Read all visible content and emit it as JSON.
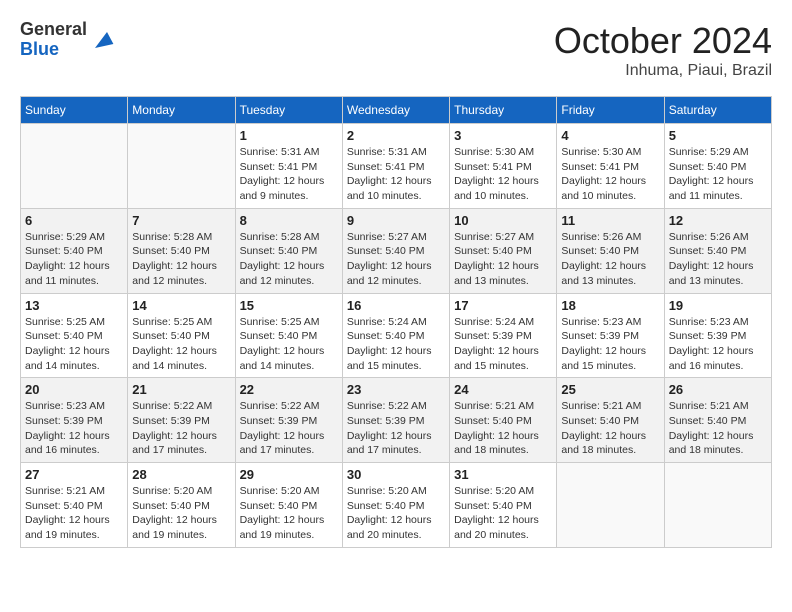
{
  "header": {
    "logo_general": "General",
    "logo_blue": "Blue",
    "month": "October 2024",
    "location": "Inhuma, Piaui, Brazil"
  },
  "weekdays": [
    "Sunday",
    "Monday",
    "Tuesday",
    "Wednesday",
    "Thursday",
    "Friday",
    "Saturday"
  ],
  "weeks": [
    [
      {
        "day": "",
        "sunrise": "",
        "sunset": "",
        "daylight": ""
      },
      {
        "day": "",
        "sunrise": "",
        "sunset": "",
        "daylight": ""
      },
      {
        "day": "1",
        "sunrise": "Sunrise: 5:31 AM",
        "sunset": "Sunset: 5:41 PM",
        "daylight": "Daylight: 12 hours and 9 minutes."
      },
      {
        "day": "2",
        "sunrise": "Sunrise: 5:31 AM",
        "sunset": "Sunset: 5:41 PM",
        "daylight": "Daylight: 12 hours and 10 minutes."
      },
      {
        "day": "3",
        "sunrise": "Sunrise: 5:30 AM",
        "sunset": "Sunset: 5:41 PM",
        "daylight": "Daylight: 12 hours and 10 minutes."
      },
      {
        "day": "4",
        "sunrise": "Sunrise: 5:30 AM",
        "sunset": "Sunset: 5:41 PM",
        "daylight": "Daylight: 12 hours and 10 minutes."
      },
      {
        "day": "5",
        "sunrise": "Sunrise: 5:29 AM",
        "sunset": "Sunset: 5:40 PM",
        "daylight": "Daylight: 12 hours and 11 minutes."
      }
    ],
    [
      {
        "day": "6",
        "sunrise": "Sunrise: 5:29 AM",
        "sunset": "Sunset: 5:40 PM",
        "daylight": "Daylight: 12 hours and 11 minutes."
      },
      {
        "day": "7",
        "sunrise": "Sunrise: 5:28 AM",
        "sunset": "Sunset: 5:40 PM",
        "daylight": "Daylight: 12 hours and 12 minutes."
      },
      {
        "day": "8",
        "sunrise": "Sunrise: 5:28 AM",
        "sunset": "Sunset: 5:40 PM",
        "daylight": "Daylight: 12 hours and 12 minutes."
      },
      {
        "day": "9",
        "sunrise": "Sunrise: 5:27 AM",
        "sunset": "Sunset: 5:40 PM",
        "daylight": "Daylight: 12 hours and 12 minutes."
      },
      {
        "day": "10",
        "sunrise": "Sunrise: 5:27 AM",
        "sunset": "Sunset: 5:40 PM",
        "daylight": "Daylight: 12 hours and 13 minutes."
      },
      {
        "day": "11",
        "sunrise": "Sunrise: 5:26 AM",
        "sunset": "Sunset: 5:40 PM",
        "daylight": "Daylight: 12 hours and 13 minutes."
      },
      {
        "day": "12",
        "sunrise": "Sunrise: 5:26 AM",
        "sunset": "Sunset: 5:40 PM",
        "daylight": "Daylight: 12 hours and 13 minutes."
      }
    ],
    [
      {
        "day": "13",
        "sunrise": "Sunrise: 5:25 AM",
        "sunset": "Sunset: 5:40 PM",
        "daylight": "Daylight: 12 hours and 14 minutes."
      },
      {
        "day": "14",
        "sunrise": "Sunrise: 5:25 AM",
        "sunset": "Sunset: 5:40 PM",
        "daylight": "Daylight: 12 hours and 14 minutes."
      },
      {
        "day": "15",
        "sunrise": "Sunrise: 5:25 AM",
        "sunset": "Sunset: 5:40 PM",
        "daylight": "Daylight: 12 hours and 14 minutes."
      },
      {
        "day": "16",
        "sunrise": "Sunrise: 5:24 AM",
        "sunset": "Sunset: 5:40 PM",
        "daylight": "Daylight: 12 hours and 15 minutes."
      },
      {
        "day": "17",
        "sunrise": "Sunrise: 5:24 AM",
        "sunset": "Sunset: 5:39 PM",
        "daylight": "Daylight: 12 hours and 15 minutes."
      },
      {
        "day": "18",
        "sunrise": "Sunrise: 5:23 AM",
        "sunset": "Sunset: 5:39 PM",
        "daylight": "Daylight: 12 hours and 15 minutes."
      },
      {
        "day": "19",
        "sunrise": "Sunrise: 5:23 AM",
        "sunset": "Sunset: 5:39 PM",
        "daylight": "Daylight: 12 hours and 16 minutes."
      }
    ],
    [
      {
        "day": "20",
        "sunrise": "Sunrise: 5:23 AM",
        "sunset": "Sunset: 5:39 PM",
        "daylight": "Daylight: 12 hours and 16 minutes."
      },
      {
        "day": "21",
        "sunrise": "Sunrise: 5:22 AM",
        "sunset": "Sunset: 5:39 PM",
        "daylight": "Daylight: 12 hours and 17 minutes."
      },
      {
        "day": "22",
        "sunrise": "Sunrise: 5:22 AM",
        "sunset": "Sunset: 5:39 PM",
        "daylight": "Daylight: 12 hours and 17 minutes."
      },
      {
        "day": "23",
        "sunrise": "Sunrise: 5:22 AM",
        "sunset": "Sunset: 5:39 PM",
        "daylight": "Daylight: 12 hours and 17 minutes."
      },
      {
        "day": "24",
        "sunrise": "Sunrise: 5:21 AM",
        "sunset": "Sunset: 5:40 PM",
        "daylight": "Daylight: 12 hours and 18 minutes."
      },
      {
        "day": "25",
        "sunrise": "Sunrise: 5:21 AM",
        "sunset": "Sunset: 5:40 PM",
        "daylight": "Daylight: 12 hours and 18 minutes."
      },
      {
        "day": "26",
        "sunrise": "Sunrise: 5:21 AM",
        "sunset": "Sunset: 5:40 PM",
        "daylight": "Daylight: 12 hours and 18 minutes."
      }
    ],
    [
      {
        "day": "27",
        "sunrise": "Sunrise: 5:21 AM",
        "sunset": "Sunset: 5:40 PM",
        "daylight": "Daylight: 12 hours and 19 minutes."
      },
      {
        "day": "28",
        "sunrise": "Sunrise: 5:20 AM",
        "sunset": "Sunset: 5:40 PM",
        "daylight": "Daylight: 12 hours and 19 minutes."
      },
      {
        "day": "29",
        "sunrise": "Sunrise: 5:20 AM",
        "sunset": "Sunset: 5:40 PM",
        "daylight": "Daylight: 12 hours and 19 minutes."
      },
      {
        "day": "30",
        "sunrise": "Sunrise: 5:20 AM",
        "sunset": "Sunset: 5:40 PM",
        "daylight": "Daylight: 12 hours and 20 minutes."
      },
      {
        "day": "31",
        "sunrise": "Sunrise: 5:20 AM",
        "sunset": "Sunset: 5:40 PM",
        "daylight": "Daylight: 12 hours and 20 minutes."
      },
      {
        "day": "",
        "sunrise": "",
        "sunset": "",
        "daylight": ""
      },
      {
        "day": "",
        "sunrise": "",
        "sunset": "",
        "daylight": ""
      }
    ]
  ]
}
